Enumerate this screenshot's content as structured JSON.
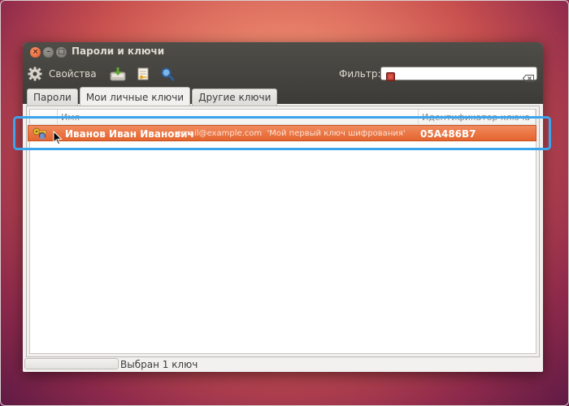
{
  "window": {
    "title": "Пароли и ключи",
    "buttons": {
      "close": "×",
      "minimize": "–",
      "maximize": "□"
    }
  },
  "toolbar": {
    "properties_label": "Свойства",
    "items": [
      "gear-icon",
      "import-icon",
      "key-sign-icon",
      "search-keys-icon"
    ],
    "filter_label": "Фильтр:",
    "filter_value": ""
  },
  "tabs": [
    {
      "label": "Пароли"
    },
    {
      "label": "Мои личные ключи",
      "active": true
    },
    {
      "label": "Другие ключи"
    }
  ],
  "table": {
    "columns": [
      "Имя",
      "Идентификатор ключа"
    ],
    "rows": [
      {
        "icon": "keypair-icon",
        "name": "Иванов Иван Иванович",
        "comment": "email@example.com  'Мой первый ключ шифрования'",
        "key_id": "05A486B7",
        "selected": true
      }
    ]
  },
  "status": {
    "text": "Выбран 1 ключ"
  },
  "colors": {
    "selection": "#e96f3c",
    "highlight": "#3aa4ec",
    "titlebar": "#3c3b37"
  }
}
